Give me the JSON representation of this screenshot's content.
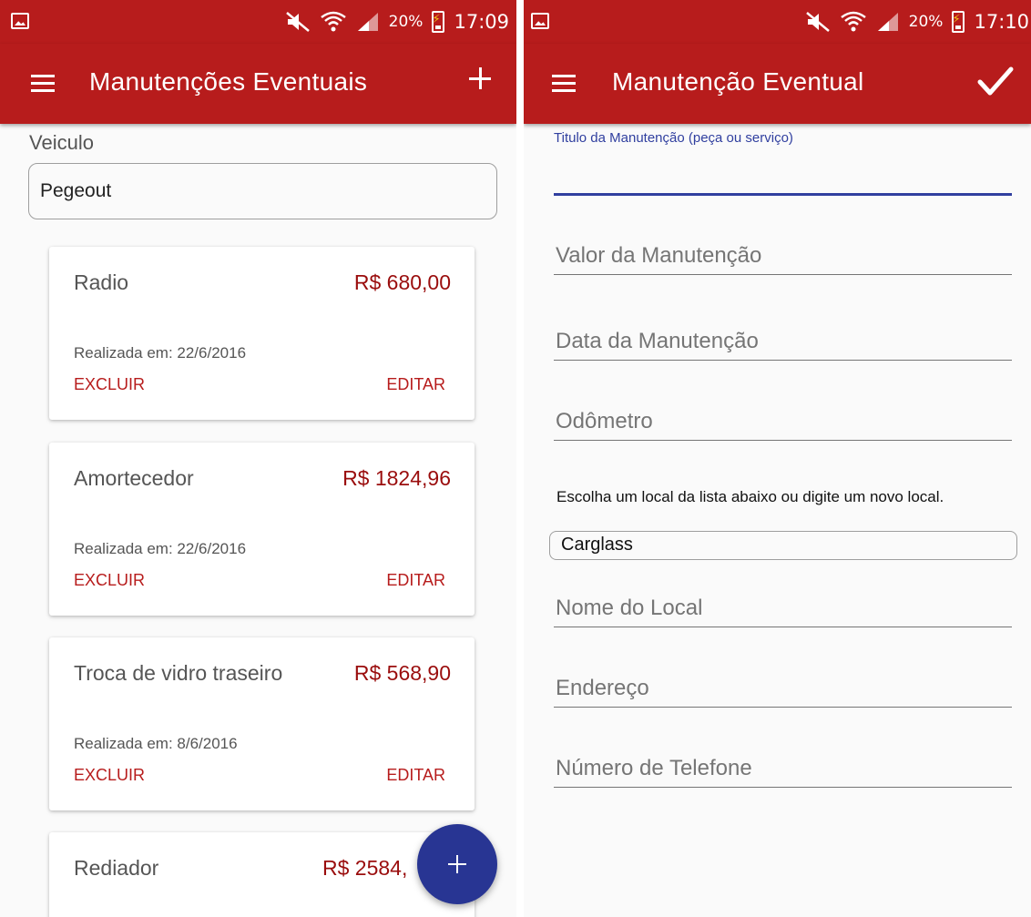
{
  "status_left": {
    "battery": "20%",
    "time": "17:09"
  },
  "status_right": {
    "battery": "20%",
    "time": "17:10"
  },
  "list_screen": {
    "title": "Manutenções Eventuais",
    "vehicle_label": "Veiculo",
    "vehicle_value": "Pegeout",
    "cards": [
      {
        "title": "Radio",
        "price": "R$ 680,00",
        "date": "Realizada em: 22/6/2016",
        "delete": "EXCLUIR",
        "edit": "EDITAR"
      },
      {
        "title": "Amortecedor",
        "price": "R$ 1824,96",
        "date": "Realizada em: 22/6/2016",
        "delete": "EXCLUIR",
        "edit": "EDITAR"
      },
      {
        "title": "Troca de vidro traseiro",
        "price": "R$ 568,90",
        "date": "Realizada em: 8/6/2016",
        "delete": "EXCLUIR",
        "edit": "EDITAR"
      },
      {
        "title": "Rediador",
        "price": "R$ 2584,"
      }
    ]
  },
  "form_screen": {
    "title": "Manutenção Eventual",
    "title_field_label": "Titulo da Manutenção (peça ou serviço)",
    "value_placeholder": "Valor da Manutenção",
    "date_placeholder": "Data da Manutenção",
    "odometer_placeholder": "Odômetro",
    "location_hint": "Escolha um local da lista abaixo ou digite um novo local.",
    "location_value": "Carglass",
    "location_name_placeholder": "Nome do Local",
    "address_placeholder": "Endereço",
    "phone_placeholder": "Número de Telefone"
  },
  "colors": {
    "primary": "#b71c1c",
    "accent": "#283593",
    "price": "#9a0d0d",
    "field_active": "#303f9f"
  },
  "icons": [
    "image-icon",
    "mute-icon",
    "wifi-icon",
    "signal-icon",
    "battery-icon",
    "menu-icon",
    "add-icon",
    "check-icon",
    "fab-add-icon"
  ]
}
